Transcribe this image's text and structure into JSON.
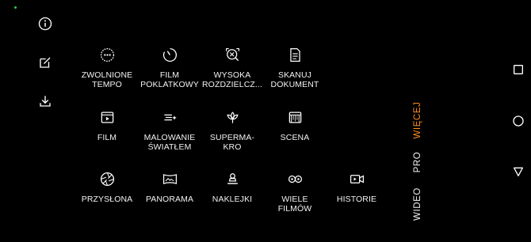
{
  "colors": {
    "background": "#000000",
    "accent": "#ff8c1a",
    "text": "#f2f2f2",
    "status_dot": "#2ecc40"
  },
  "left_toolbar": [
    {
      "name": "info-icon"
    },
    {
      "name": "edit-icon"
    },
    {
      "name": "download-icon"
    }
  ],
  "modes": [
    {
      "label": "ZWOLNIONE\nTEMPO",
      "icon": "slow-motion-icon"
    },
    {
      "label": "FILM\nPOKLATKOWY",
      "icon": "timelapse-icon"
    },
    {
      "label": "WYSOKA\nROZDZIELCZ...",
      "icon": "high-resolution-icon"
    },
    {
      "label": "SKANUJ\nDOKUMENT",
      "icon": "document-scan-icon"
    },
    {
      "label": "FILM",
      "icon": "film-icon"
    },
    {
      "label": "MALOWANIE\nŚWIATŁEM",
      "icon": "light-painting-icon"
    },
    {
      "label": "SUPERMA-\nKRO",
      "icon": "super-macro-icon"
    },
    {
      "label": "SCENA",
      "icon": "scene-icon"
    },
    {
      "label": "PRZYSŁONA",
      "icon": "aperture-icon"
    },
    {
      "label": "PANORAMA",
      "icon": "panorama-icon"
    },
    {
      "label": "NAKLEJKI",
      "icon": "stickers-icon"
    },
    {
      "label": "WIELE\nFILMÓW",
      "icon": "multi-video-icon"
    },
    {
      "label": "HISTORIE",
      "icon": "stories-icon"
    }
  ],
  "mode_tabs": {
    "more": "WIĘCEJ",
    "pro": "PRO",
    "video": "WIDEO",
    "active": "WIĘCEJ"
  },
  "nav_buttons": [
    {
      "name": "recents-icon"
    },
    {
      "name": "home-icon"
    },
    {
      "name": "back-icon"
    }
  ]
}
